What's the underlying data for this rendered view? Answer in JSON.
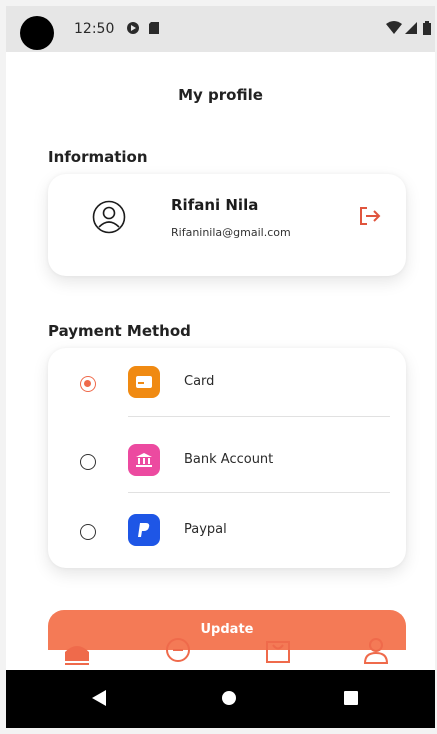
{
  "status_bar": {
    "time": "12:50",
    "left_icons": [
      "sync-icon",
      "sd-card-icon"
    ],
    "right_icons": [
      "wifi-icon",
      "signal-icon",
      "battery-icon"
    ]
  },
  "page": {
    "title": "My profile"
  },
  "information": {
    "heading": "Information",
    "name": "Rifani Nila",
    "email": "Rifaninila@gmail.com",
    "avatar_icon": "user-avatar-icon",
    "logout_icon": "logout-icon"
  },
  "payment": {
    "heading": "Payment Method",
    "options": [
      {
        "label": "Card",
        "icon": "card-icon",
        "icon_color": "#f08a12",
        "selected": true
      },
      {
        "label": "Bank Account",
        "icon": "bank-icon",
        "icon_color": "#ec4aa0",
        "selected": false
      },
      {
        "label": "Paypal",
        "icon": "paypal-icon",
        "icon_color": "#1e56e6",
        "selected": false
      }
    ]
  },
  "actions": {
    "update_label": "Update"
  },
  "tab_bar": {
    "tabs": [
      "home-icon",
      "chat-icon",
      "bag-icon",
      "profile-icon"
    ],
    "active_color": "#ef6a4b"
  },
  "colors": {
    "accent": "#f47a56"
  }
}
